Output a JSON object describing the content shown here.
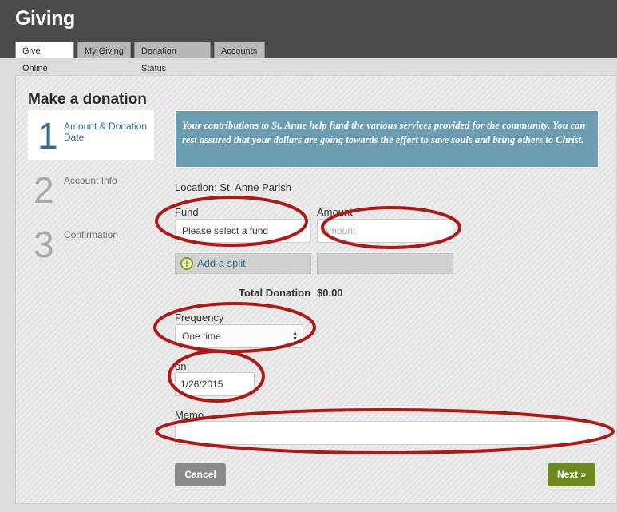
{
  "header": {
    "title": "Giving",
    "tabs": [
      {
        "label": "Give Online",
        "active": true
      },
      {
        "label": "My Giving",
        "active": false
      },
      {
        "label": "Donation Status",
        "active": false
      },
      {
        "label": "Accounts",
        "active": false
      }
    ]
  },
  "page": {
    "title": "Make a donation"
  },
  "steps": [
    {
      "number": "1",
      "label": "Amount & Donation Date",
      "active": true
    },
    {
      "number": "2",
      "label": "Account Info",
      "active": false
    },
    {
      "number": "3",
      "label": "Confirmation",
      "active": false
    }
  ],
  "info_text": "Your contributions to St. Anne help fund the various services provided for the community. You can rest assured that your dollars are going towards the effort to save souls and bring others to Christ.",
  "form": {
    "location": "Location: St. Anne Parish",
    "fund_label": "Fund",
    "fund_value": "Please select a fund",
    "amount_label": "Amount",
    "amount_placeholder": "Amount",
    "add_split_label": "Add a split",
    "total_label": "Total Donation",
    "total_value": "$0.00",
    "frequency_label": "Frequency",
    "frequency_value": "One time",
    "on_label": "on",
    "date_value": "1/26/2015",
    "memo_label": "Memo",
    "memo_value": ""
  },
  "buttons": {
    "cancel": "Cancel",
    "next": "Next »"
  },
  "colors": {
    "header_bg": "#4a4a4a",
    "accent_blue": "#2f6e93",
    "info_bg": "#6b9cb0",
    "next_green": "#6d8a1e",
    "annotation_red": "#b01818"
  }
}
